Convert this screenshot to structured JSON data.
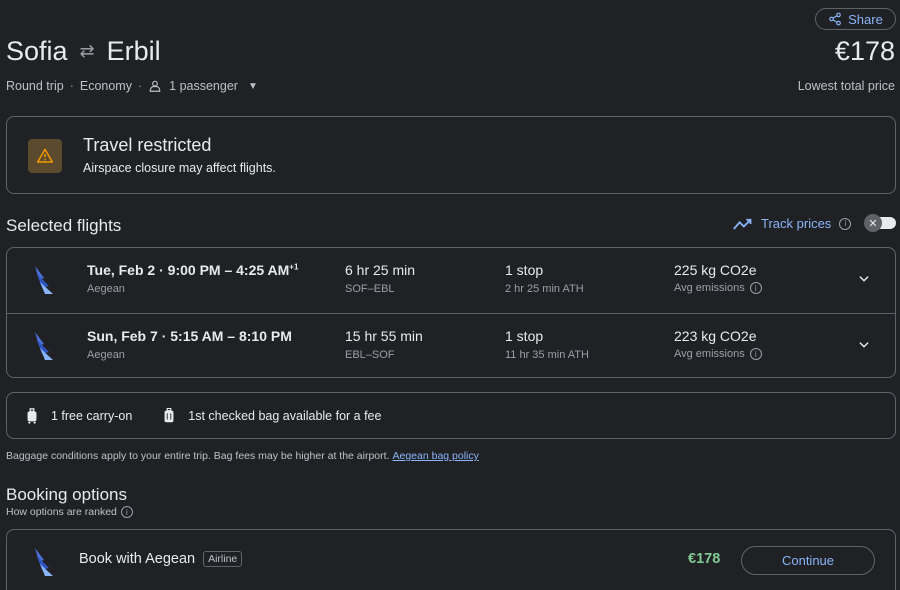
{
  "header": {
    "share_label": "Share",
    "origin": "Sofia",
    "destination": "Erbil",
    "swap_icon": "⇄",
    "price": "€178",
    "price_note": "Lowest total price",
    "trip_type": "Round trip",
    "cabin": "Economy",
    "passengers": "1 passenger"
  },
  "restriction": {
    "title": "Travel restricted",
    "subtitle": "Airspace closure may affect flights.",
    "icon": "warning-icon",
    "icon_bg": "#5c4a2f",
    "icon_color": "#f29900"
  },
  "selected": {
    "title": "Selected flights",
    "track_label": "Track prices"
  },
  "flights": [
    {
      "date": "Tue, Feb 2",
      "times": "9:00 PM – 4:25 AM",
      "plus_days": "+1",
      "airline": "Aegean",
      "duration": "6 hr 25 min",
      "route": "SOF–EBL",
      "stops": "1 stop",
      "stop_detail": "2 hr 25 min ATH",
      "emissions": "225 kg CO2e",
      "emissions_note": "Avg emissions"
    },
    {
      "date": "Sun, Feb 7",
      "times": "5:15 AM – 8:10 PM",
      "plus_days": "",
      "airline": "Aegean",
      "duration": "15 hr 55 min",
      "route": "EBL–SOF",
      "stops": "1 stop",
      "stop_detail": "11 hr 35 min ATH",
      "emissions": "223 kg CO2e",
      "emissions_note": "Avg emissions"
    }
  ],
  "baggage": {
    "carry_on": "1 free carry-on",
    "checked": "1st checked bag available for a fee",
    "note": "Baggage conditions apply to your entire trip. Bag fees may be higher at the airport.",
    "policy_link": "Aegean bag policy"
  },
  "booking": {
    "title": "Booking options",
    "how_ranked": "How options are ranked",
    "option_label": "Book with Aegean",
    "option_badge": "Airline",
    "option_price": "€178",
    "continue_label": "Continue"
  },
  "colors": {
    "background": "#202124",
    "accent": "#8ab4f8",
    "price_green": "#81c995",
    "border": "#5f6368"
  }
}
